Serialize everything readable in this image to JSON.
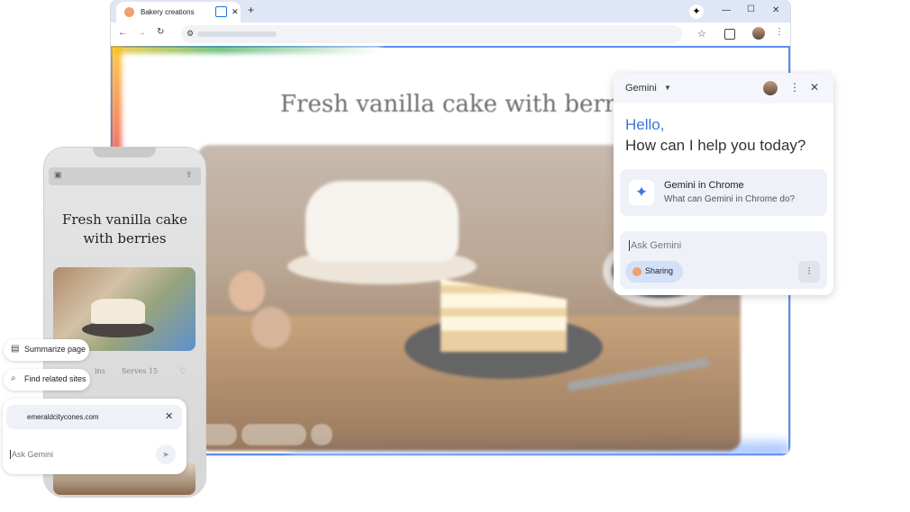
{
  "browser": {
    "tab_title": "Bakery creations",
    "new_tab_symbol": "+",
    "tab_close_symbol": "✕",
    "window_controls": {
      "minimize": "—",
      "maximize": "☐",
      "close": "✕"
    },
    "nav": {
      "back": "←",
      "forward": "→",
      "reload": "↻"
    },
    "toolbar_icons": [
      "bookmark-star-icon",
      "extensions-icon",
      "profile-avatar",
      "menu-kebab-icon"
    ]
  },
  "page": {
    "heading": "Fresh vanilla cake with berries"
  },
  "gemini_panel": {
    "title": "Gemini",
    "greeting_line1": "Hello,",
    "greeting_line2": "How can I help you today?",
    "suggestion_title": "Gemini in Chrome",
    "suggestion_subtitle": "What can Gemini in Chrome do?",
    "input_placeholder": "Ask Gemini",
    "sharing_label": "Sharing"
  },
  "phone": {
    "recipe_title_line1": "Fresh vanilla cake",
    "recipe_title_line2": "with berries",
    "meta_left": "ins",
    "meta_serves": "Serves 15",
    "chips": {
      "summarize": "Summarize page",
      "find_related": "Find related sites"
    },
    "site_chip": "emeraldcitycones.com",
    "input_placeholder": "Ask Gemini"
  },
  "colors": {
    "gemini_blue": "#3b76d8",
    "tabstrip": "#dfe6f6",
    "sharing_chip": "#d3e0f9"
  }
}
